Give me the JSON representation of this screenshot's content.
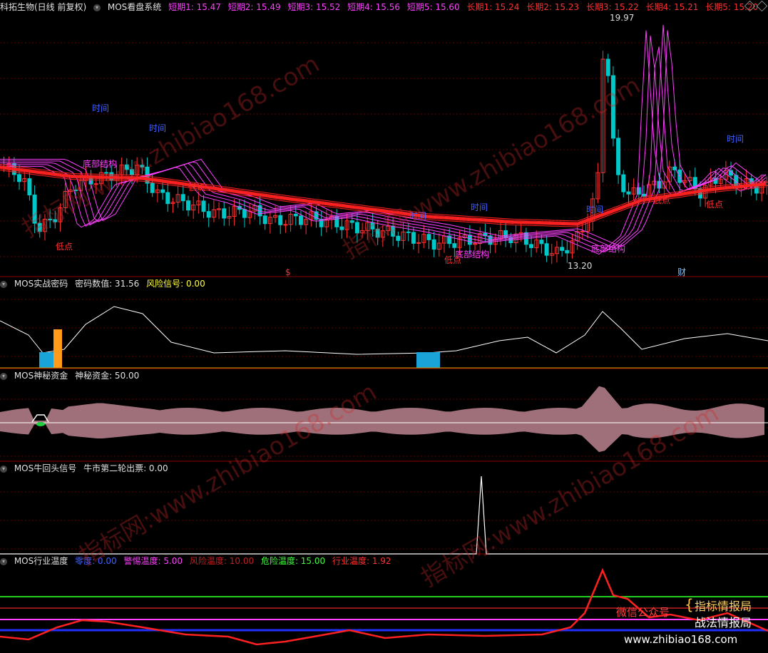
{
  "colors": {
    "bg": "#000000",
    "up": "#ff3232",
    "down": "#00c8c8",
    "grid": "#600000",
    "divider": "#8b0000",
    "short": "#ff40ff",
    "long": "#ff2020",
    "blue": "#3030ff"
  },
  "main": {
    "stock": "科拓生物(日线 前复权)",
    "indicator": "MOS看盘系统",
    "short": [
      "短期1: 15.47",
      "短期2: 15.49",
      "短期3: 15.52",
      "短期4: 15.56",
      "短期5: 15.60"
    ],
    "long": [
      "长期1: 15.24",
      "长期2: 15.23",
      "长期3: 15.22",
      "长期4: 15.21",
      "长期5: 15.20"
    ],
    "high_label": "19.97",
    "low_label": "13.20",
    "annotations": {
      "time": "时间",
      "bottom": "底部结构",
      "low": "低点",
      "dollar": "$",
      "cai": "财"
    }
  },
  "panel2": {
    "name": "MOS实战密码",
    "v1": "密码数值: 31.56",
    "v2": "风险信号: 0.00"
  },
  "panel3": {
    "name": "MOS神秘资金",
    "v1": "神秘资金: 50.00"
  },
  "panel4": {
    "name": "MOS牛回头信号",
    "v1": "牛市第二轮出票: 0.00"
  },
  "panel5": {
    "name": "MOS行业温度",
    "v1": "零度: 0.00",
    "v2": "警惕温度: 5.00",
    "v3": "风险温度: 10.00",
    "v4": "危险温度: 15.00",
    "v5": "行业温度: 1.92"
  },
  "watermark": {
    "site": "www.zhibiao168.com",
    "cn": "指标网:",
    "footer": "www.zhibiao168.com"
  },
  "promo": {
    "wechat": "微信公众号",
    "a": "指标情报局",
    "b": "战法情报局"
  },
  "chart_data": {
    "type": "line",
    "price_range": [
      13.2,
      19.97
    ],
    "short_ma": [
      15.47,
      15.49,
      15.52,
      15.56,
      15.6
    ],
    "long_ma": [
      15.24,
      15.23,
      15.22,
      15.21,
      15.2
    ],
    "password_value": 31.56,
    "risk_signal": 0.0,
    "mystery_fund": 50.0,
    "bull_signal": 0.0,
    "temperature_levels": {
      "zero": 0.0,
      "alert": 5.0,
      "risk": 10.0,
      "danger": 15.0,
      "industry": 1.92
    }
  }
}
